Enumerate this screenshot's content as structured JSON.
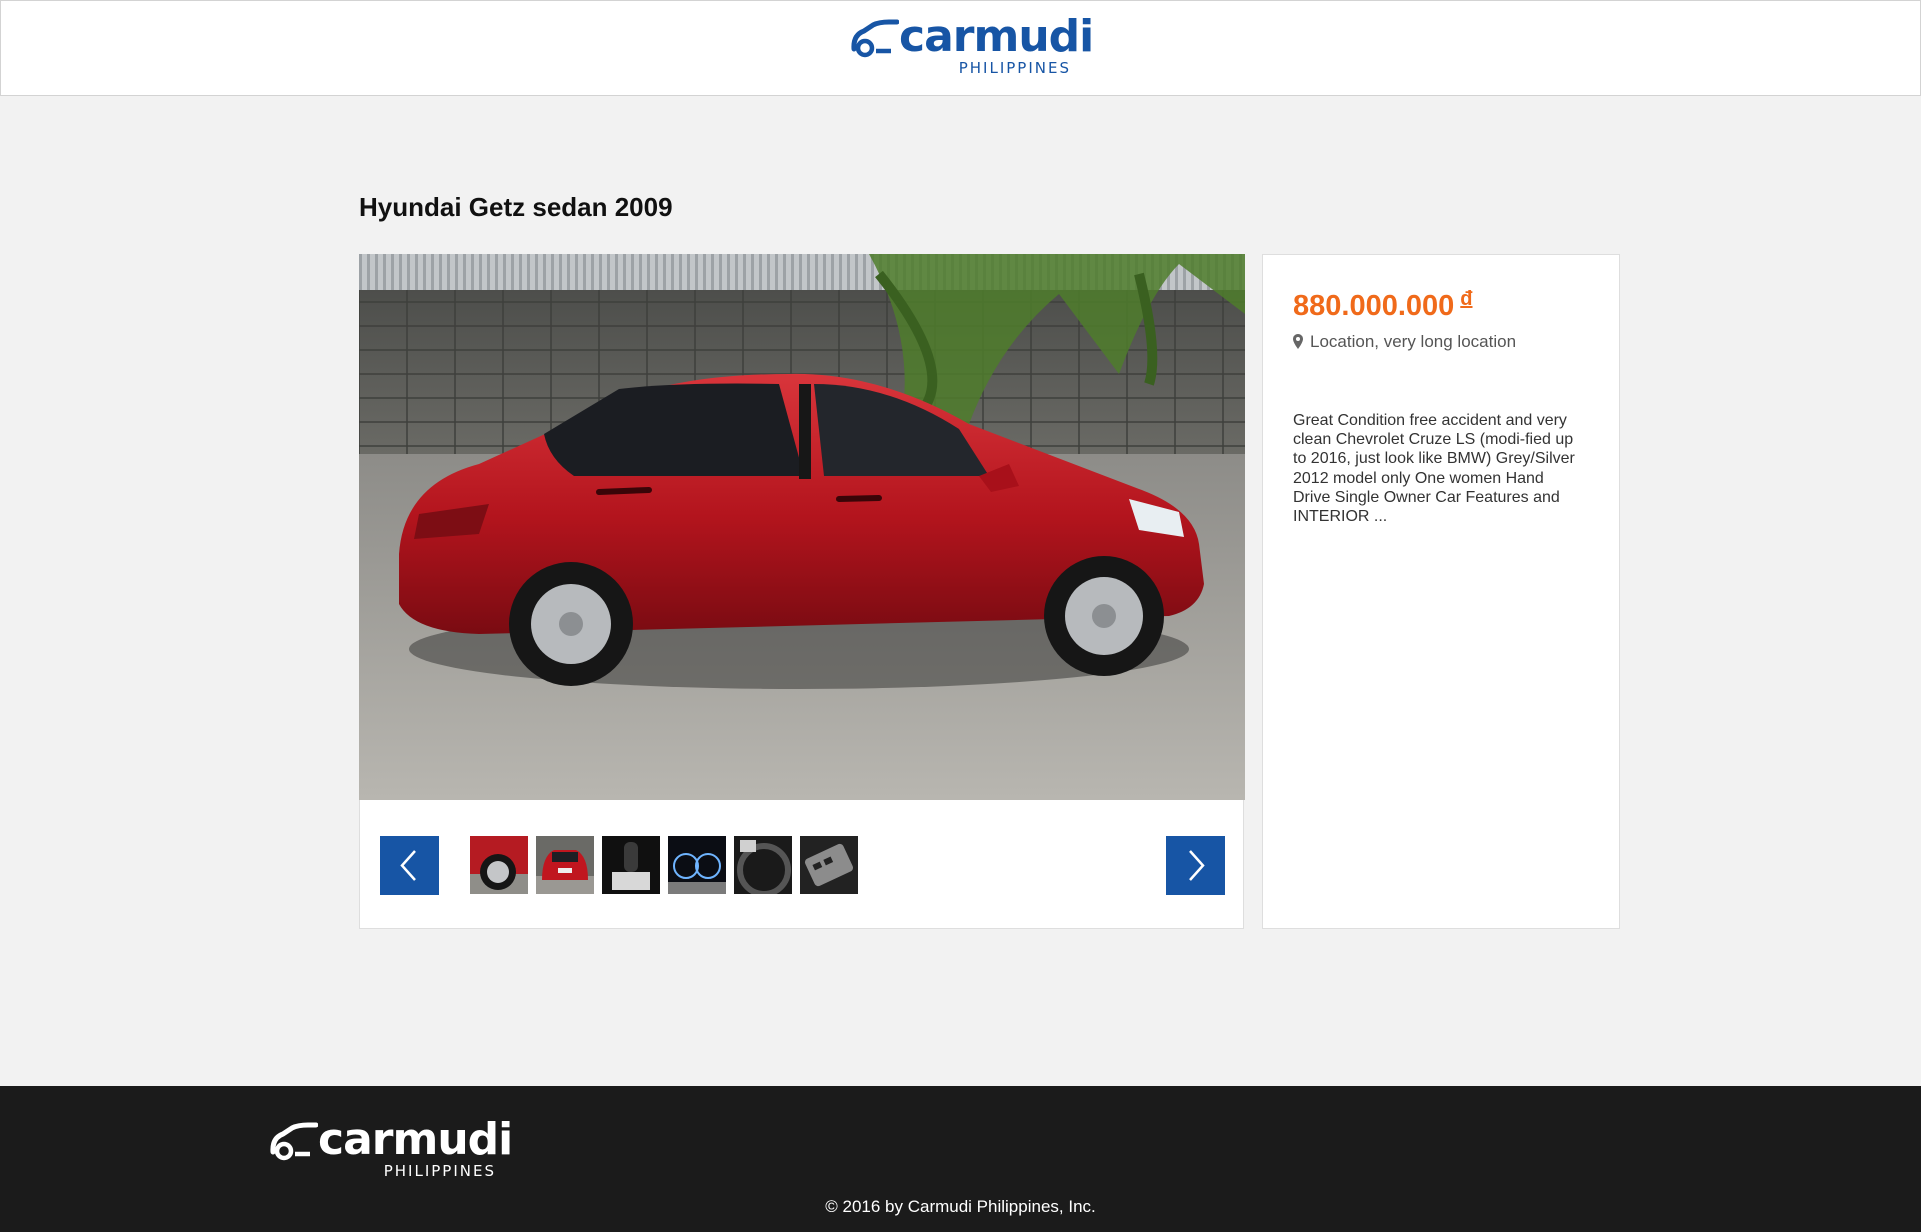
{
  "header": {
    "logo": {
      "wordmark": "carmudi",
      "region": "PHILIPPINES"
    }
  },
  "listing": {
    "title": "Hyundai Getz sedan 2009",
    "price": "880.000.000",
    "currency_symbol": "đ",
    "location": "Location, very long location",
    "description": "Great Condition free accident and very clean Chevrolet Cruze LS (modi-fied up to 2016, just look like BMW) Grey/Silver 2012 model only One women Hand Drive Single Owner Car Features and INTERIOR ...",
    "main_photo": "red sedan parked beside concrete block wall",
    "thumbnails": [
      "wheel photo",
      "rear view photo",
      "gear shift photo",
      "instrument cluster photo",
      "steering wheel photo",
      "door control panel photo"
    ]
  },
  "gallery_nav": {
    "prev_icon": "chevron-left-icon",
    "next_icon": "chevron-right-icon"
  },
  "footer": {
    "logo": {
      "wordmark": "carmudi",
      "region": "PHILIPPINES"
    },
    "copyright": "© 2016 by Carmudi Philippines, Inc."
  },
  "colors": {
    "brand_blue": "#1755a5",
    "price_orange": "#f06a1a",
    "footer_bg": "#1b1b1b",
    "page_bg": "#f2f2f2"
  }
}
